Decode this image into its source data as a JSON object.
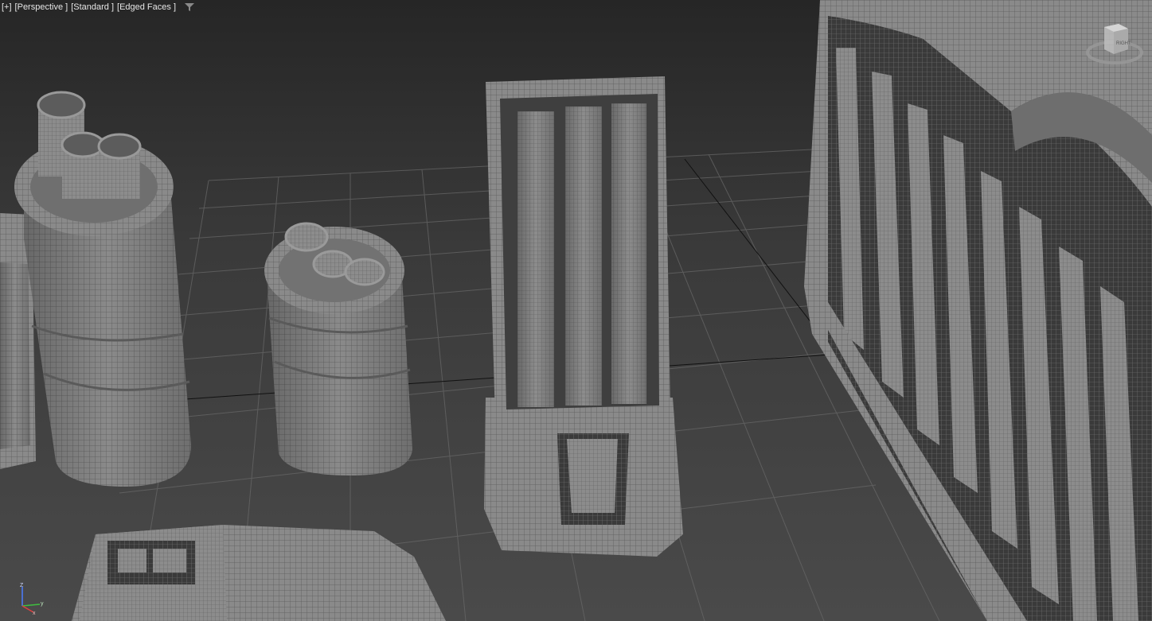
{
  "viewport": {
    "labels": {
      "plus": "[+]",
      "view": "[Perspective ]",
      "shading": "[Standard ]",
      "display": "[Edged Faces ]"
    },
    "viewcube_face": "RIGHT",
    "axis_labels": {
      "z": "Z",
      "y": "y",
      "x": "x"
    },
    "icons": [
      "filter-icon",
      "viewcube-icon",
      "axis-tripod-icon"
    ],
    "colors": {
      "background_top": "#262626",
      "background_bottom": "#4a4a4a",
      "mesh": "#8a8a8a",
      "wire": "#5c5c5c",
      "grid": "#6a6a6a"
    }
  }
}
